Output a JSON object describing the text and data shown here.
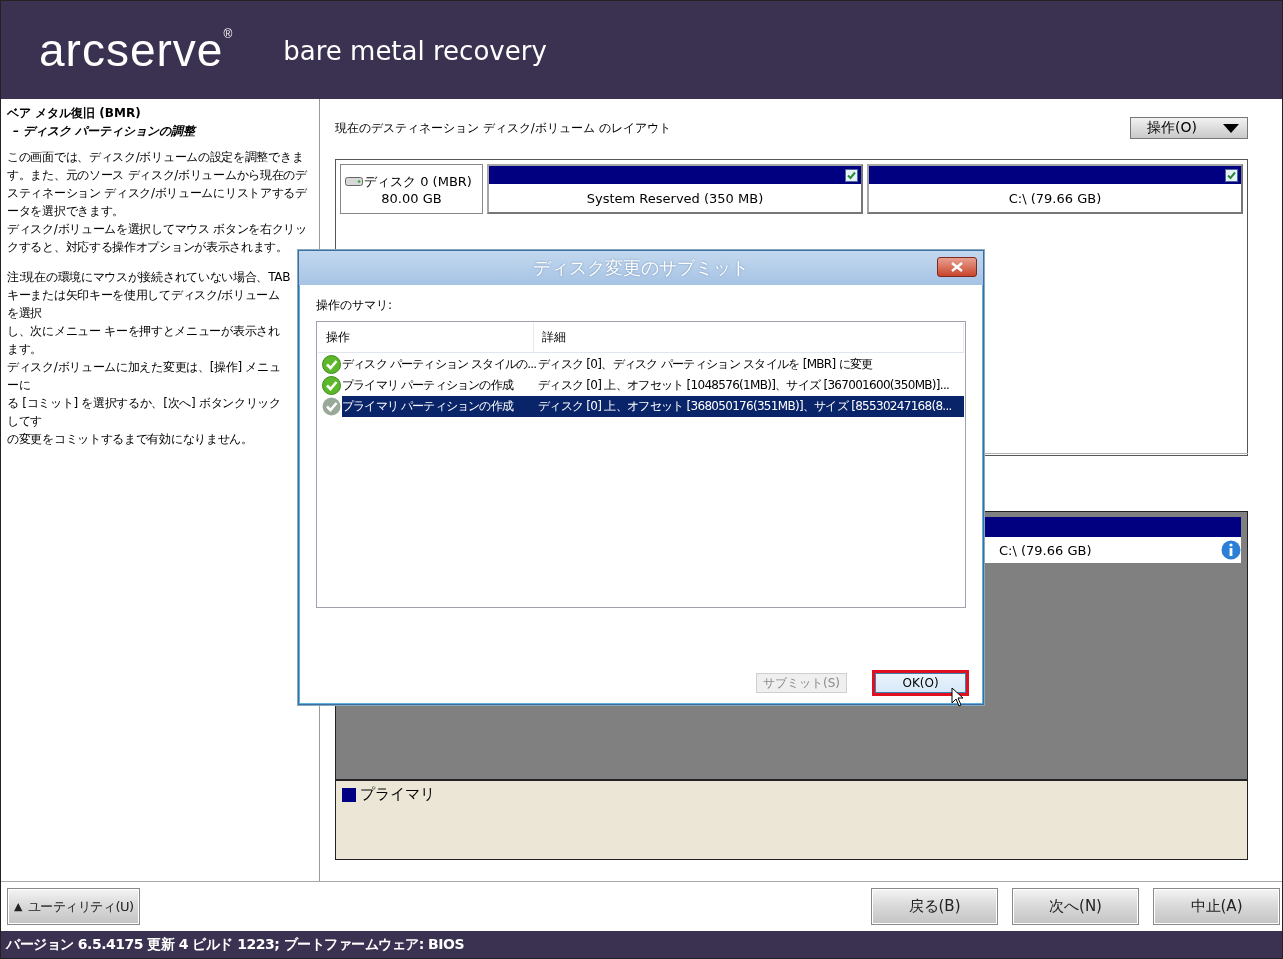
{
  "header": {
    "logo": "arcserve$^{®}$",
    "product": "bare metal recovery"
  },
  "left_panel": {
    "title": "ベア メタル復旧 (BMR)",
    "subtitle": "– ディスク パーティションの調整",
    "paragraphs": [
      "この画面では、ディスク/ボリュームの設定を調整できます。また、元のソース ディスク/ボリュームから現在のデスティネーション ディスク/ボリュームにリストアするデータを選択できます。",
      "ディスク/ボリュームを選択してマウス ボタンを右クリックすると、対応する操作オプションが表示されます。"
    ],
    "note_lines": [
      "注:現在の環境にマウスが接続されていない場合、TAB",
      "キーまたは矢印キーを使用してディスク/ボリュームを選択",
      "し、次にメニュー キーを押すとメニューが表示されます。",
      "ディスク/ボリュームに加えた変更は、[操作] メニューに",
      "る [コミット] を選択するか、[次へ] ボタンクリックしてす",
      "の変更をコミットするまで有効になりません。"
    ]
  },
  "layout": {
    "label": "現在のデスティネーション ディスク/ボリューム のレイアウト",
    "operation_button": "操作(O)",
    "disk": {
      "name": "ディスク 0 (MBR)",
      "size": "80.00 GB",
      "partitions": [
        {
          "label": "System Reserved (350 MB)",
          "checked": true
        },
        {
          "label": "C:\\ (79.66 GB)",
          "checked": true
        }
      ]
    }
  },
  "source_layout": {
    "partition": {
      "label": "C:\\ (79.66 GB)"
    },
    "legend": [
      {
        "label": "プライマリ",
        "color": "#000080"
      }
    ]
  },
  "dialog": {
    "title": "ディスク変更のサブミット",
    "summary_label": "操作のサマリ:",
    "columns": [
      "操作",
      "詳細"
    ],
    "rows": [
      {
        "operation": "ディスク パーティション スタイルの...",
        "detail": "ディスク [0]、ディスク パーティション スタイルを [MBR] に変更",
        "selected": false
      },
      {
        "operation": "プライマリ パーティションの作成",
        "detail": "ディスク [0] 上、オフセット [1048576(1MB)]、サイズ [367001600(350MB)]...",
        "selected": false
      },
      {
        "operation": "プライマリ パーティションの作成",
        "detail": "ディスク [0] 上、オフセット [368050176(351MB)]、サイズ [85530247168(8...",
        "selected": true
      }
    ],
    "buttons": [
      {
        "label": "サブミット(S)",
        "disabled": true,
        "focused": false
      },
      {
        "label": "OK(O)",
        "disabled": false,
        "focused": true
      }
    ]
  },
  "footer": {
    "utility_button": "ユーティリティ(U)",
    "utility_arrow": "▲",
    "nav_buttons": [
      "戻る(B)",
      "次へ(N)",
      "中止(A)"
    ]
  },
  "status_bar": "バージョン 6.5.4175 更新 4 ビルド 1223; ブートファームウェア: BIOS"
}
